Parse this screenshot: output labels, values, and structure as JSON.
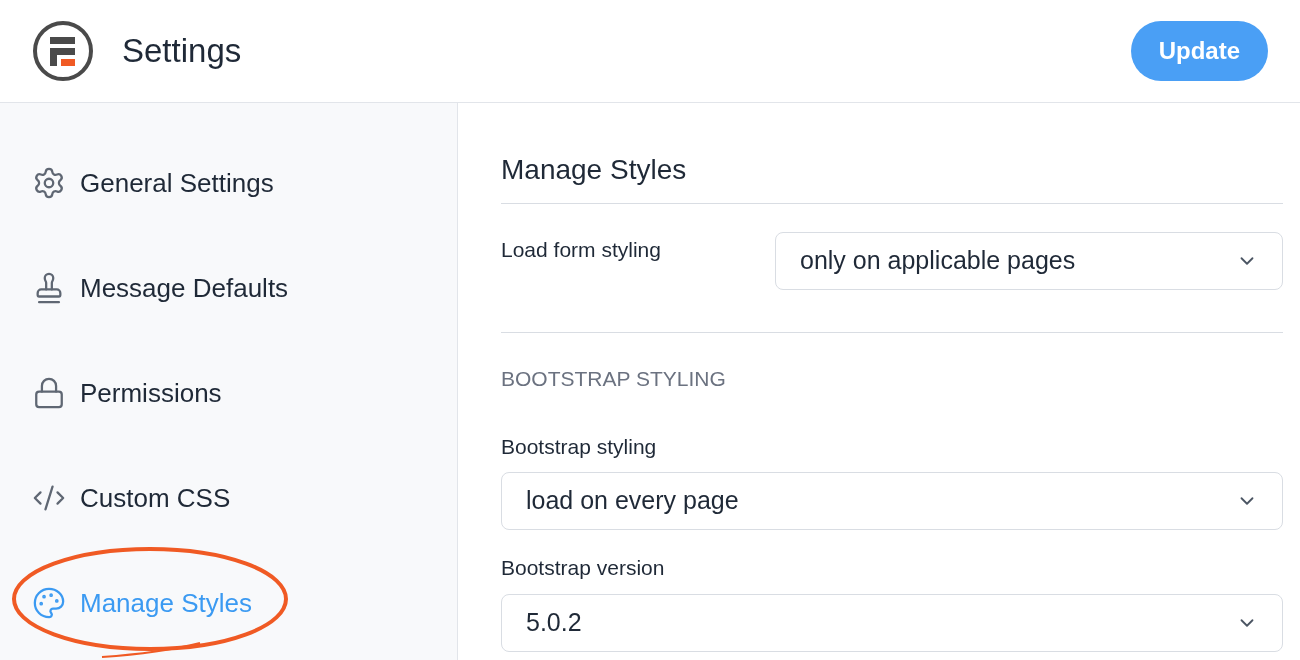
{
  "header": {
    "title": "Settings",
    "button": "Update"
  },
  "sidebar": {
    "items": [
      {
        "label": "General Settings",
        "kind": "gear",
        "selected": false,
        "circled": false
      },
      {
        "label": "Message Defaults",
        "kind": "stamp",
        "selected": false,
        "circled": false
      },
      {
        "label": "Permissions",
        "kind": "lock",
        "selected": false,
        "circled": false
      },
      {
        "label": "Custom CSS",
        "kind": "code",
        "selected": false,
        "circled": false
      },
      {
        "label": "Manage Styles",
        "kind": "palette",
        "selected": true,
        "circled": true
      }
    ]
  },
  "panel": {
    "title": "Manage Styles",
    "sections": [
      {
        "fields": [
          {
            "label": "Load form styling",
            "value": "only on applicable pages",
            "kind": "inline"
          }
        ]
      },
      {
        "heading": "BOOTSTRAP STYLING",
        "fields": [
          {
            "label": "Bootstrap styling",
            "value": "load on every page",
            "kind": "stacked"
          },
          {
            "label": "Bootstrap version",
            "value": "5.0.2",
            "kind": "stacked"
          }
        ]
      }
    ]
  }
}
